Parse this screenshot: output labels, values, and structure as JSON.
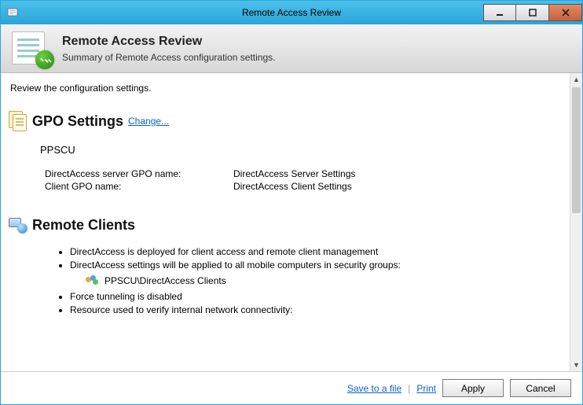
{
  "window": {
    "title": "Remote Access Review"
  },
  "header": {
    "title": "Remote Access Review",
    "subtitle": "Summary of Remote Access configuration settings."
  },
  "content": {
    "intro": "Review the configuration settings.",
    "gpo": {
      "heading": "GPO Settings",
      "change_link": "Change...",
      "org": "PPSCU",
      "server_label": "DirectAccess server GPO name:",
      "server_value": "DirectAccess Server Settings",
      "client_label": "Client GPO name:",
      "client_value": "DirectAccess Client Settings"
    },
    "clients": {
      "heading": "Remote Clients",
      "bullets": {
        "b1": "DirectAccess is deployed for client access and remote client management",
        "b2": "DirectAccess settings will be applied to all mobile computers in security groups:",
        "group": "PPSCU\\DirectAccess Clients",
        "b3": "Force tunneling is disabled",
        "b4": "Resource used to verify internal network connectivity:"
      }
    }
  },
  "footer": {
    "save_link": "Save to a file",
    "print_link": "Print",
    "apply": "Apply",
    "cancel": "Cancel"
  }
}
